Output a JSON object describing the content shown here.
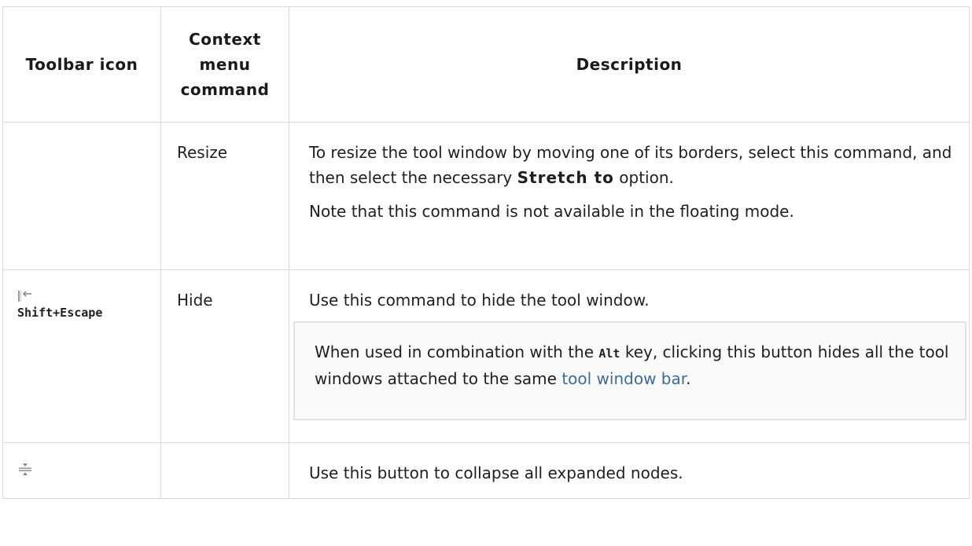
{
  "table": {
    "headers": {
      "icon": "Toolbar icon",
      "command": "Context menu command",
      "description": "Description"
    },
    "rows": [
      {
        "command": "Resize",
        "description": {
          "p1_before": "To resize the tool window by moving one of its borders, select this command, and then select the necessary ",
          "p1_term": "Stretch to",
          "p1_after": " option.",
          "p2": "Note that this command is not available in the floating mode."
        }
      },
      {
        "icon_name": "hide-icon",
        "shortcut": "Shift+Escape",
        "command": "Hide",
        "description": {
          "p1": "Use this command to hide the tool window.",
          "tip_before": "When used in combination with the ",
          "tip_key": "Alt",
          "tip_middle": " key, clicking this button hides all the tool windows attached to the same ",
          "tip_link": "tool window bar",
          "tip_after": "."
        }
      },
      {
        "icon_name": "collapse-all-icon",
        "command": "",
        "description": {
          "p1": "Use this button to collapse all expanded nodes."
        }
      }
    ]
  },
  "colors": {
    "link": "#3a6d9c",
    "border": "#dadada",
    "tip_background": "#fafafa"
  }
}
